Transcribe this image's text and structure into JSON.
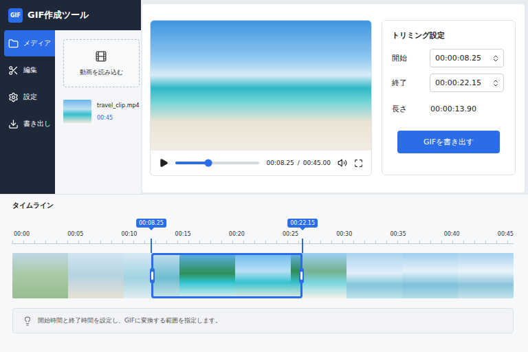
{
  "app": {
    "logo": "GIF",
    "title": "GIF作成ツール"
  },
  "sidebar": {
    "items": [
      {
        "label": "メディア",
        "selected": true
      },
      {
        "label": "編集",
        "selected": false
      },
      {
        "label": "設定",
        "selected": false
      },
      {
        "label": "書き出し",
        "selected": false
      }
    ]
  },
  "media": {
    "import_button": "動画を読み込む",
    "files": [
      {
        "name": "travel_clip.mp4",
        "duration": "00:45"
      }
    ]
  },
  "player": {
    "playing": false,
    "level": 0.39,
    "current": "00:08.25",
    "separator": "/",
    "total": "00:45.00"
  },
  "trim": {
    "title": "トリミング設定",
    "fields": [
      {
        "label": "開始",
        "value": "00:00:08.25"
      },
      {
        "label": "終了",
        "value": "00:00:22.15"
      }
    ],
    "length_label": "長さ",
    "length": "00:00:13.90",
    "export_button": "GIFを書き出す"
  },
  "timeline": {
    "title": "タイムライン",
    "ticks": [
      "00:00",
      "00:05",
      "00:10",
      "00:15",
      "00:20",
      "00:25",
      "00:30",
      "00:35",
      "00:40",
      "00:45"
    ],
    "start_marker": "00:08.25",
    "end_marker": "00:22.15",
    "range_start": 0.277,
    "range_end": 0.579
  },
  "hint": "開始時間と終了時間を設定し、GIFに変換する範囲を指定します。"
}
